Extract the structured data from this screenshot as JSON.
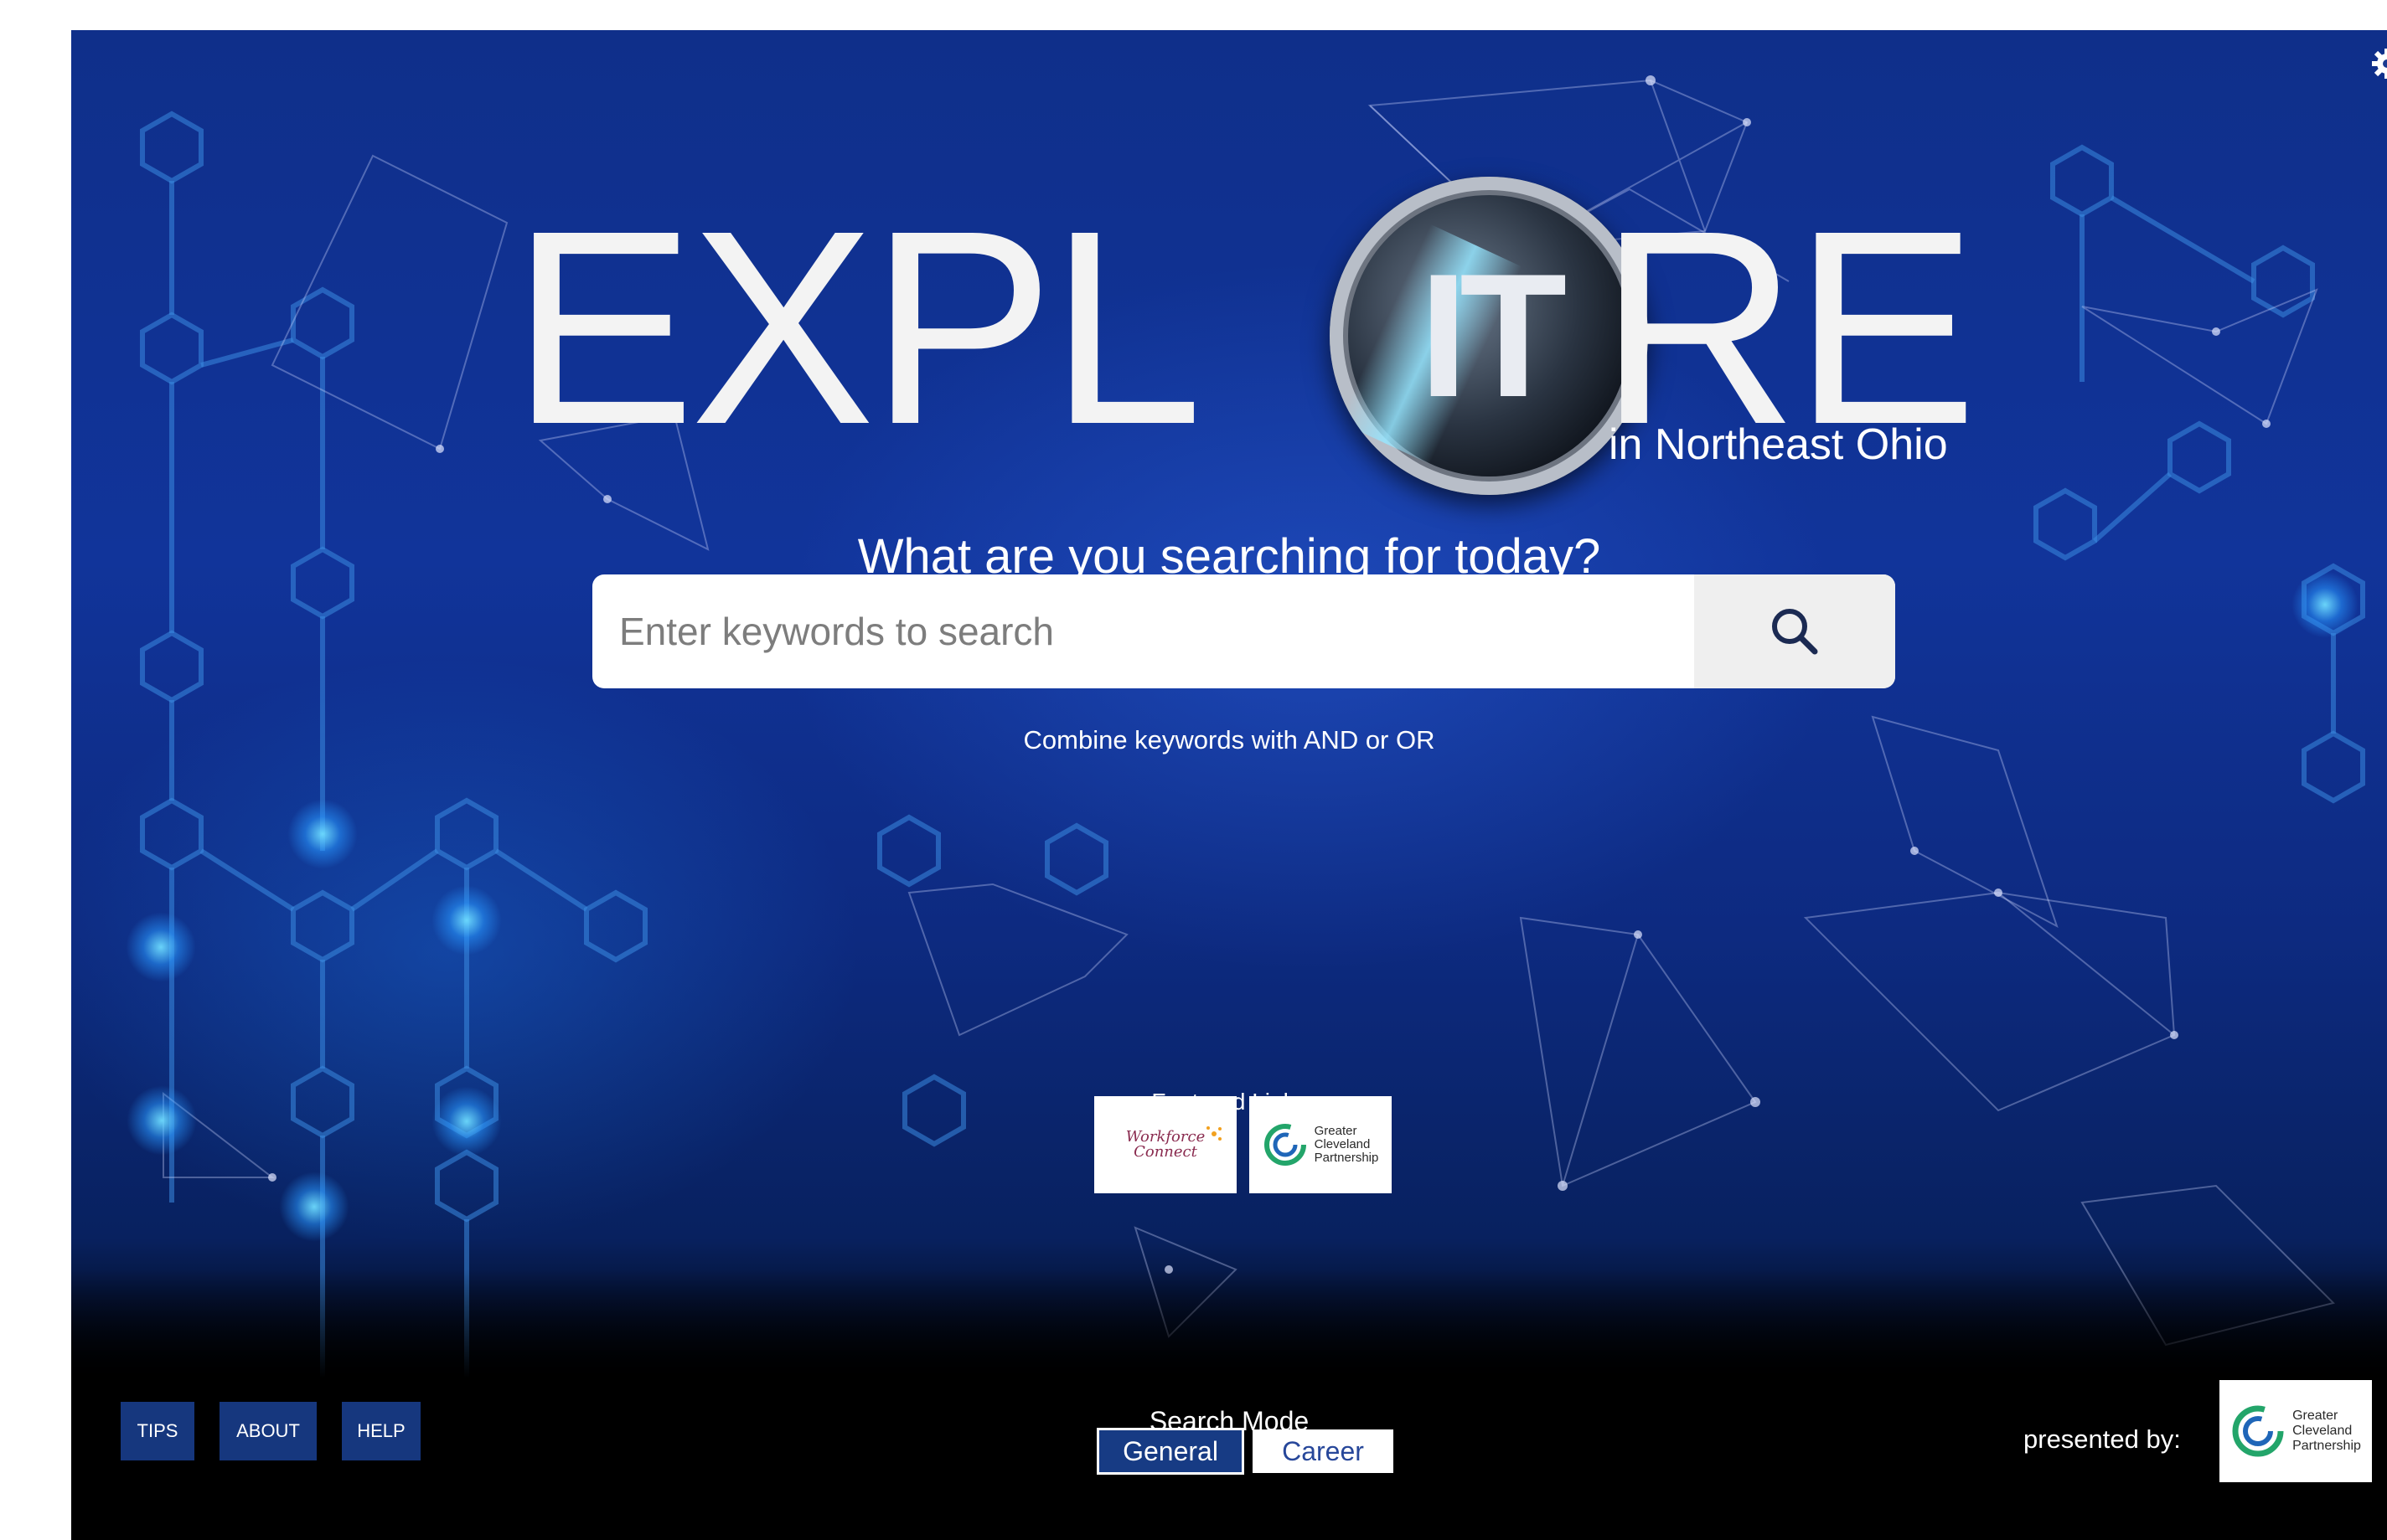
{
  "logo": {
    "left_text": "EXPL",
    "orb_text": "IT",
    "right_text": "RE",
    "tagline": "in Northeast Ohio"
  },
  "search": {
    "heading": "What are you searching for today?",
    "placeholder": "Enter keywords to search",
    "hint": "Combine keywords with AND or OR"
  },
  "featured": {
    "title": "Featured Links",
    "links": [
      {
        "line1": "Workforce",
        "line2": "Connect"
      },
      {
        "line1": "Greater",
        "line2": "Cleveland",
        "line3": "Partnership"
      }
    ]
  },
  "footer": {
    "tips_label": "TIPS",
    "about_label": "ABOUT",
    "help_label": "HELP",
    "search_mode_label": "Search Mode",
    "modes": [
      {
        "label": "General",
        "selected": true
      },
      {
        "label": "Career",
        "selected": false
      }
    ],
    "presented_by": "presented by:",
    "presenter": {
      "line1": "Greater",
      "line2": "Cleveland",
      "line3": "Partnership"
    }
  },
  "icons": {
    "search": "search-icon",
    "settings": "gear-icon"
  },
  "colors": {
    "background": "#11349a",
    "footer": "#000000",
    "footer_button": "#16377e",
    "mode_selected": "#173b84",
    "presenter_green": "#23a56a",
    "presenter_blue": "#1f66b8"
  }
}
